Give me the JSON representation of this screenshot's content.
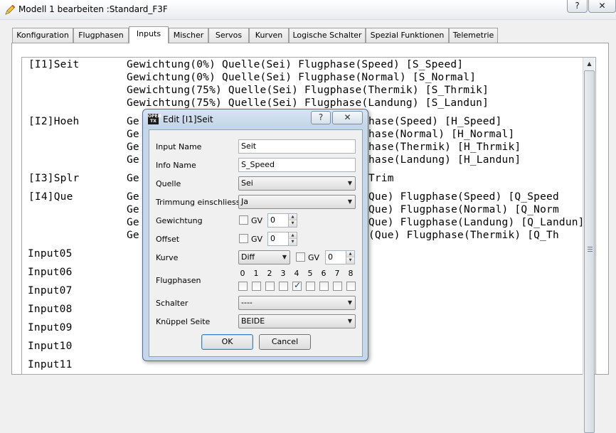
{
  "window": {
    "title": "Modell 1 bearbeiten :Standard_F3F",
    "help_glyph": "?",
    "close_glyph": "✕"
  },
  "tabs": [
    {
      "label": "Konfiguration"
    },
    {
      "label": "Flugphasen"
    },
    {
      "label": "Inputs",
      "active": true
    },
    {
      "label": "Mischer"
    },
    {
      "label": "Servos"
    },
    {
      "label": "Kurven"
    },
    {
      "label": "Logische Schalter"
    },
    {
      "label": "Spezial Funktionen"
    },
    {
      "label": "Telemetrie"
    }
  ],
  "inputs_list": {
    "lines": [
      {
        "left": "[I1]Seit",
        "right": "Gewichtung(0%) Quelle(Sei) Flugphase(Speed) [S_Speed]"
      },
      {
        "left": "",
        "right": "Gewichtung(0%) Quelle(Sei) Flugphase(Normal) [S_Normal]"
      },
      {
        "left": "",
        "right": "Gewichtung(75%) Quelle(Sei) Flugphase(Thermik) [S_Thrmik]"
      },
      {
        "left": "",
        "right": "Gewichtung(75%) Quelle(Sei) Flugphase(Landung) [S_Landun]"
      },
      {
        "left": "[I2]Hoeh",
        "right": "Ge",
        "tail": "hase(Speed) [H_Speed]"
      },
      {
        "left": "",
        "right": "Ge",
        "tail": "hase(Normal) [H_Normal]"
      },
      {
        "left": "",
        "right": "Ge",
        "tail": "hase(Thermik) [H_Thrmik]"
      },
      {
        "left": "",
        "right": "Ge",
        "tail": "hase(Landung) [H_Landun]"
      },
      {
        "left": "[I3]Splr",
        "right": "Ge",
        "tail": "Trim"
      },
      {
        "left": "[I4]Que",
        "right": "Ge",
        "tail": "Que) Flugphase(Speed) [Q_Speed"
      },
      {
        "left": "",
        "right": "Ge",
        "tail": "Que) Flugphase(Normal) [Q_Norm"
      },
      {
        "left": "",
        "right": "Ge",
        "tail": "Que) Flugphase(Landung) [Q_Landun]"
      },
      {
        "left": "",
        "right": "Ge",
        "tail": "(Que) Flugphase(Thermik) [Q_Th"
      }
    ],
    "empty_inputs": [
      "Input05",
      "Input06",
      "Input07",
      "Input08",
      "Input09",
      "Input10",
      "Input11"
    ]
  },
  "dialog": {
    "title": "Edit [I1]Seit",
    "logo_text": "OPEN TX",
    "help_glyph": "?",
    "close_glyph": "✕",
    "input_name_label": "Input Name",
    "input_name_value": "Seit",
    "info_name_label": "Info Name",
    "info_name_value": "S_Speed",
    "quelle_label": "Quelle",
    "quelle_value": "Sei",
    "trimmung_label": "Trimmung einschliessen",
    "trimmung_value": "Ja",
    "gewichtung_label": "Gewichtung",
    "gewichtung_gv_label": "GV",
    "gewichtung_value": "0",
    "offset_label": "Offset",
    "offset_gv_label": "GV",
    "offset_value": "0",
    "kurve_label": "Kurve",
    "kurve_value": "Diff",
    "kurve_gv_label": "GV",
    "kurve_spin_value": "0",
    "flugphasen_label": "Flugphasen",
    "flugphasen_digits": [
      "0",
      "1",
      "2",
      "3",
      "4",
      "5",
      "6",
      "7",
      "8"
    ],
    "flugphasen_checked_index": 4,
    "schalter_label": "Schalter",
    "schalter_value": "----",
    "knueppel_label": "Knüppel Seite",
    "knueppel_value": "BEIDE",
    "ok_label": "OK",
    "cancel_label": "Cancel"
  }
}
